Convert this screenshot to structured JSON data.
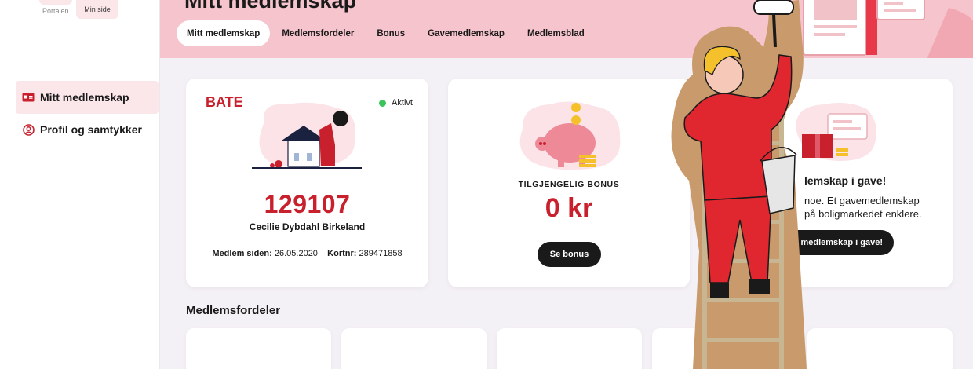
{
  "portal_tabs": {
    "portal": "Portalen",
    "my_page": "Min side"
  },
  "sidebar": {
    "items": [
      {
        "label": "Mitt medlemskap",
        "icon": "id-card-icon"
      },
      {
        "label": "Profil og samtykker",
        "icon": "user-circle-icon"
      }
    ]
  },
  "header": {
    "title": "Mitt medlemskap",
    "tabs": [
      {
        "label": "Mitt medlemskap",
        "active": true
      },
      {
        "label": "Medlemsfordeler"
      },
      {
        "label": "Bonus"
      },
      {
        "label": "Gavemedlemskap"
      },
      {
        "label": "Medlemsblad"
      }
    ]
  },
  "membership_card": {
    "logo": "BATE",
    "status": "Aktivt",
    "member_number": "129107",
    "name": "Cecilie Dybdahl Birkeland",
    "member_since_label": "Medlem siden:",
    "member_since": "26.05.2020",
    "card_no_label": "Kortnr:",
    "card_no": "289471858"
  },
  "bonus_card": {
    "label": "TILGJENGELIG BONUS",
    "value": "0 kr",
    "button": "Se bonus"
  },
  "gift_card": {
    "title": "lemskap i gave!",
    "text_line1": "noe. Et gavemedlemskap",
    "text_line2": "på boligmarkedet enklere.",
    "button": "et medlemskap i gave!"
  },
  "benefits": {
    "title": "Medlemsfordeler"
  },
  "colors": {
    "brand_red": "#c8202d",
    "header_pink": "#f6c4cc",
    "active_pink": "#fbe6ea",
    "status_green": "#3cc45a"
  }
}
